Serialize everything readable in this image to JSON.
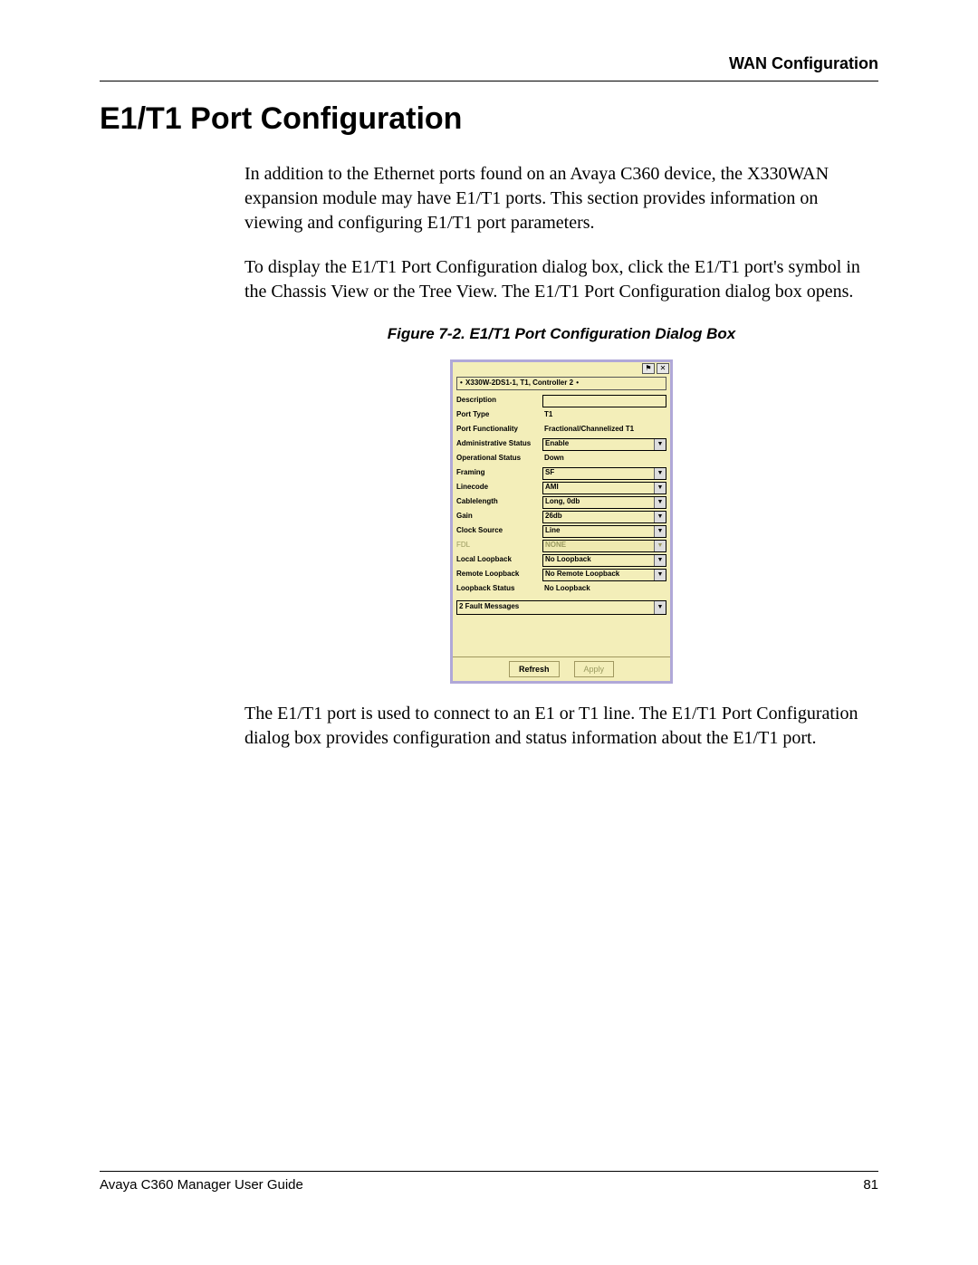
{
  "header": {
    "running_head": "WAN Configuration"
  },
  "title": "E1/T1 Port Configuration",
  "paragraphs": {
    "p1": "In addition to the Ethernet ports found on an Avaya C360 device, the X330WAN expansion module may have E1/T1 ports. This section provides information on viewing and configuring E1/T1 port parameters.",
    "p2": "To display the E1/T1 Port Configuration dialog box, click the E1/T1 port's symbol in the Chassis View or the Tree View. The E1/T1 Port Configuration dialog box opens.",
    "p3": "The E1/T1 port is used to connect to an E1 or T1 line. The E1/T1 Port Configuration dialog box provides configuration and status information about the E1/T1 port."
  },
  "figure": {
    "caption": "Figure 7-2.  E1/T1 Port Configuration Dialog Box"
  },
  "dialog": {
    "breadcrumb": "X330W-2DS1-1, T1, Controller 2",
    "fields": [
      {
        "label": "Description",
        "value": "",
        "kind": "input"
      },
      {
        "label": "Port Type",
        "value": "T1",
        "kind": "static"
      },
      {
        "label": "Port Functionality",
        "value": "Fractional/Channelized T1",
        "kind": "static"
      },
      {
        "label": "Administrative Status",
        "value": "Enable",
        "kind": "select"
      },
      {
        "label": "Operational Status",
        "value": "Down",
        "kind": "static"
      },
      {
        "label": "Framing",
        "value": "SF",
        "kind": "select"
      },
      {
        "label": "Linecode",
        "value": "AMI",
        "kind": "select"
      },
      {
        "label": "Cablelength",
        "value": "Long, 0db",
        "kind": "select"
      },
      {
        "label": "Gain",
        "value": "26db",
        "kind": "select"
      },
      {
        "label": "Clock Source",
        "value": "Line",
        "kind": "select"
      },
      {
        "label": "FDL",
        "value": "NONE",
        "kind": "select-disabled"
      },
      {
        "label": "Local Loopback",
        "value": "No Loopback",
        "kind": "select"
      },
      {
        "label": "Remote Loopback",
        "value": "No Remote Loopback",
        "kind": "select"
      },
      {
        "label": "Loopback Status",
        "value": "No Loopback",
        "kind": "static"
      }
    ],
    "fault": "2 Fault Messages",
    "buttons": {
      "refresh": "Refresh",
      "apply": "Apply"
    }
  },
  "footer": {
    "doc": "Avaya C360 Manager User Guide",
    "page": "81"
  }
}
